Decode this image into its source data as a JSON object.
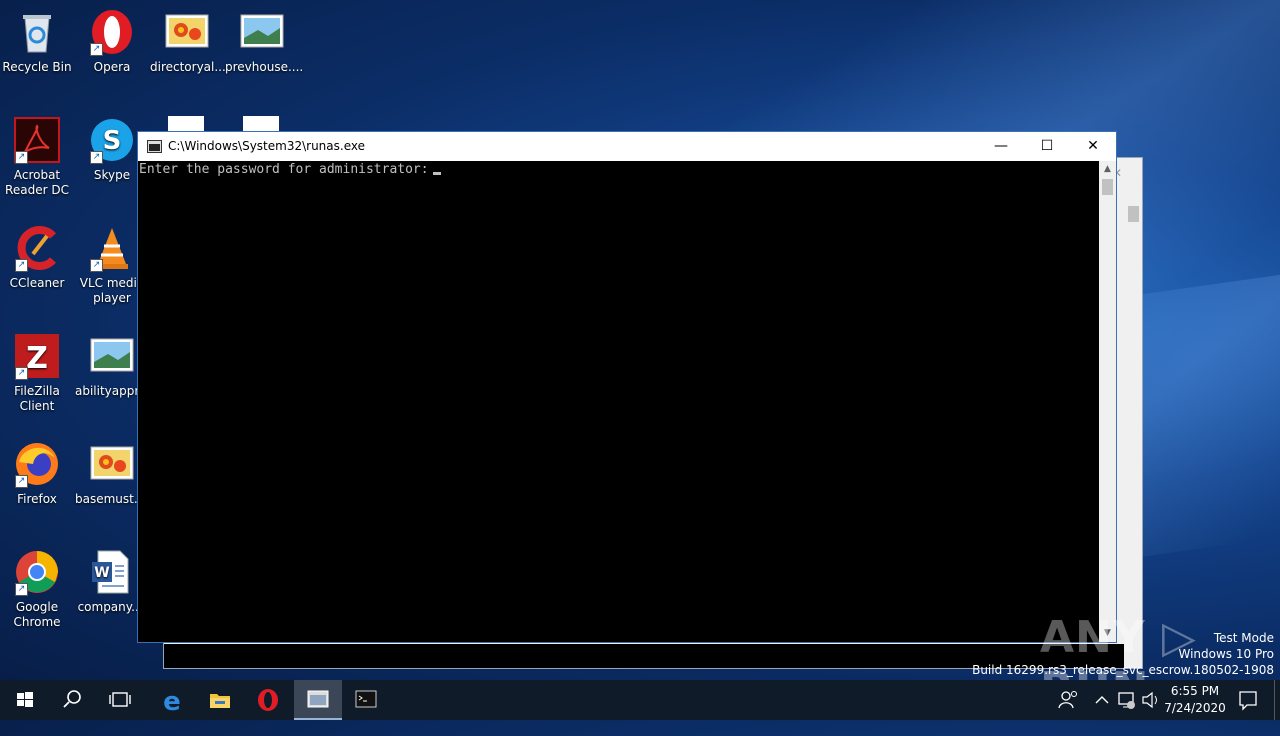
{
  "desktop": {
    "icons": [
      {
        "label": "Recycle Bin",
        "icon": "recycle-bin-icon"
      },
      {
        "label": "Opera",
        "icon": "opera-icon"
      },
      {
        "label": "directoryal...",
        "icon": "image-file-icon"
      },
      {
        "label": "prevhouse....",
        "icon": "image-file-icon"
      },
      {
        "label": "Acrobat Reader DC",
        "icon": "acrobat-icon"
      },
      {
        "label": "Skype",
        "icon": "skype-icon"
      },
      {
        "label": "CCleaner",
        "icon": "ccleaner-icon"
      },
      {
        "label": "VLC media player",
        "icon": "vlc-icon"
      },
      {
        "label": "FileZilla Client",
        "icon": "filezilla-icon"
      },
      {
        "label": "abilityappra...",
        "icon": "image-file-icon"
      },
      {
        "label": "Firefox",
        "icon": "firefox-icon"
      },
      {
        "label": "basemust....",
        "icon": "image-file-icon"
      },
      {
        "label": "Google Chrome",
        "icon": "chrome-icon"
      },
      {
        "label": "company....",
        "icon": "word-doc-icon"
      }
    ]
  },
  "window": {
    "title": "C:\\Windows\\System32\\runas.exe",
    "minimize": "—",
    "maximize": "☐",
    "close": "✕",
    "console_text": "Enter the password for administrator:"
  },
  "watermark": "ANY ▷ RUN",
  "test_mode": {
    "line1": "Test Mode",
    "line2": "Windows 10 Pro",
    "line3": "Build 16299.rs3_release_svc_escrow.180502-1908"
  },
  "taskbar": {
    "time": "6:55 PM",
    "date": "7/24/2020",
    "items": [
      "start-button",
      "search-button",
      "task-view-button",
      "edge-icon",
      "file-explorer-icon",
      "opera-taskbar-icon",
      "runas-taskbar-item",
      "cmd-taskbar-item"
    ]
  },
  "colors": {
    "accent": "#3b6fb6",
    "taskbar": "#101b2a",
    "console_bg": "#000000",
    "console_fg": "#c0c0c0"
  }
}
